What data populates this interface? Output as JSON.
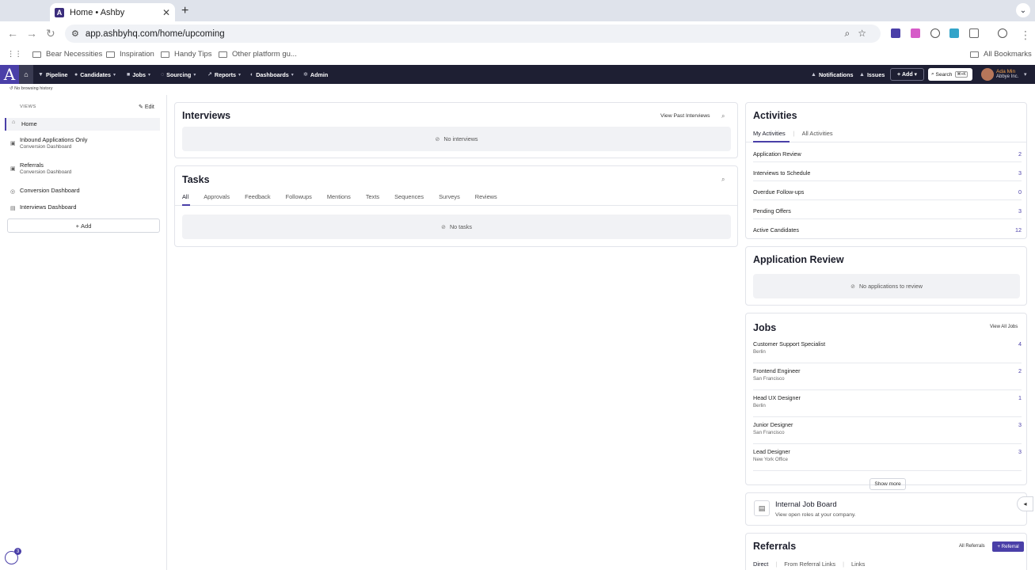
{
  "browser": {
    "tab_title": "Home • Ashby",
    "url": "app.ashbyhq.com/home/upcoming",
    "bookmarks": [
      "Bear Necessities",
      "Inspiration",
      "Handy Tips",
      "Other platform gu..."
    ],
    "all_bookmarks": "All Bookmarks"
  },
  "header": {
    "logo": "A",
    "nav": [
      "Pipeline",
      "Candidates",
      "Jobs",
      "Sourcing",
      "Reports",
      "Dashboards",
      "Admin"
    ],
    "notifications": "Notifications",
    "issues": "Issues",
    "add": "Add",
    "search": "Search",
    "search_kbd": "⌘+K",
    "user_name": "Ada Min",
    "user_org": "Abbye Inc."
  },
  "history_text": "No browsing history",
  "sidebar": {
    "views_label": "VIEWS",
    "edit": "Edit",
    "items": [
      {
        "title": "Home",
        "sub": ""
      },
      {
        "title": "Inbound Applications Only",
        "sub": "Conversion Dashboard"
      },
      {
        "title": "Referrals",
        "sub": "Conversion Dashboard"
      },
      {
        "title": "Conversion Dashboard",
        "sub": ""
      },
      {
        "title": "Interviews Dashboard",
        "sub": ""
      }
    ],
    "add": "Add",
    "badge_count": "3"
  },
  "interviews": {
    "title": "Interviews",
    "view_past": "View Past Interviews",
    "empty": "No interviews"
  },
  "tasks": {
    "title": "Tasks",
    "tabs": [
      "All",
      "Approvals",
      "Feedback",
      "Followups",
      "Mentions",
      "Texts",
      "Sequences",
      "Surveys",
      "Reviews"
    ],
    "empty": "No tasks"
  },
  "activities": {
    "title": "Activities",
    "tabs": [
      "My Activities",
      "All Activities"
    ],
    "rows": [
      {
        "label": "Application Review",
        "value": "2"
      },
      {
        "label": "Interviews to Schedule",
        "value": "3"
      },
      {
        "label": "Overdue Follow-ups",
        "value": "0"
      },
      {
        "label": "Pending Offers",
        "value": "3"
      },
      {
        "label": "Active Candidates",
        "value": "12"
      }
    ]
  },
  "app_review": {
    "title": "Application Review",
    "empty": "No applications to review"
  },
  "jobs": {
    "title": "Jobs",
    "view_all": "View All Jobs",
    "rows": [
      {
        "title": "Customer Support Specialist",
        "location": "Berlin",
        "count": "4"
      },
      {
        "title": "Frontend Engineer",
        "location": "San Francisco",
        "count": "2"
      },
      {
        "title": "Head UX Designer",
        "location": "Berlin",
        "count": "1"
      },
      {
        "title": "Junior Designer",
        "location": "San Francisco",
        "count": "3"
      },
      {
        "title": "Lead Designer",
        "location": "New York Office",
        "count": "3"
      }
    ],
    "show_more": "Show more"
  },
  "job_board": {
    "title": "Internal Job Board",
    "sub": "View open roles at your company."
  },
  "referrals": {
    "title": "Referrals",
    "all": "All Referrals",
    "button": "+ Referral",
    "tabs": [
      "Direct",
      "From Referral Links",
      "Links"
    ]
  }
}
